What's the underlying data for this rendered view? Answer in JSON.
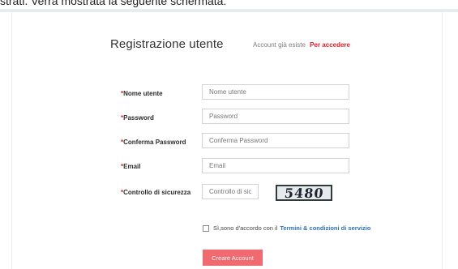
{
  "page": {
    "caption": "strati. Verrà mostrata la seguente schermata:"
  },
  "header": {
    "title": "Registrazione utente",
    "login_hint": "Account già esiste",
    "login_link": "Per accedere"
  },
  "form": {
    "required_mark": "*",
    "fields": [
      {
        "label": "Nome utente",
        "placeholder": "Nome utente"
      },
      {
        "label": "Password",
        "placeholder": "Password"
      },
      {
        "label": "Conferma Password",
        "placeholder": "Conferma Password"
      },
      {
        "label": "Email",
        "placeholder": "Email"
      }
    ],
    "captcha": {
      "label": "Controllo di sicurezza",
      "placeholder": "Controllo di sicu",
      "code": "5480"
    },
    "terms": {
      "text": "Sì,sono d'accordo con il",
      "link": "Termini & condizioni di servizio"
    },
    "submit_label": "Creare Account"
  }
}
